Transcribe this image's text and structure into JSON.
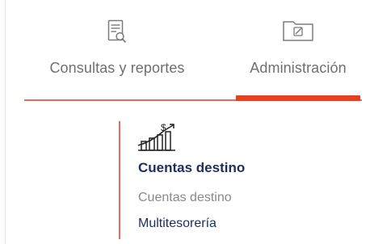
{
  "tabs": [
    {
      "label": "Consultas y reportes",
      "icon": "document-search-icon",
      "active": false
    },
    {
      "label": "Administración",
      "icon": "folder-edit-icon",
      "active": true
    }
  ],
  "colors": {
    "accent": "#e6401e",
    "accent_line": "#e86b5c",
    "title_text": "#1b2f5c",
    "muted_text": "#8a8a8a"
  },
  "panel": {
    "icon": "money-growth-chart-icon",
    "title": "Cuentas destino",
    "subtitle": "Cuentas destino",
    "link": "Multitesorería"
  }
}
